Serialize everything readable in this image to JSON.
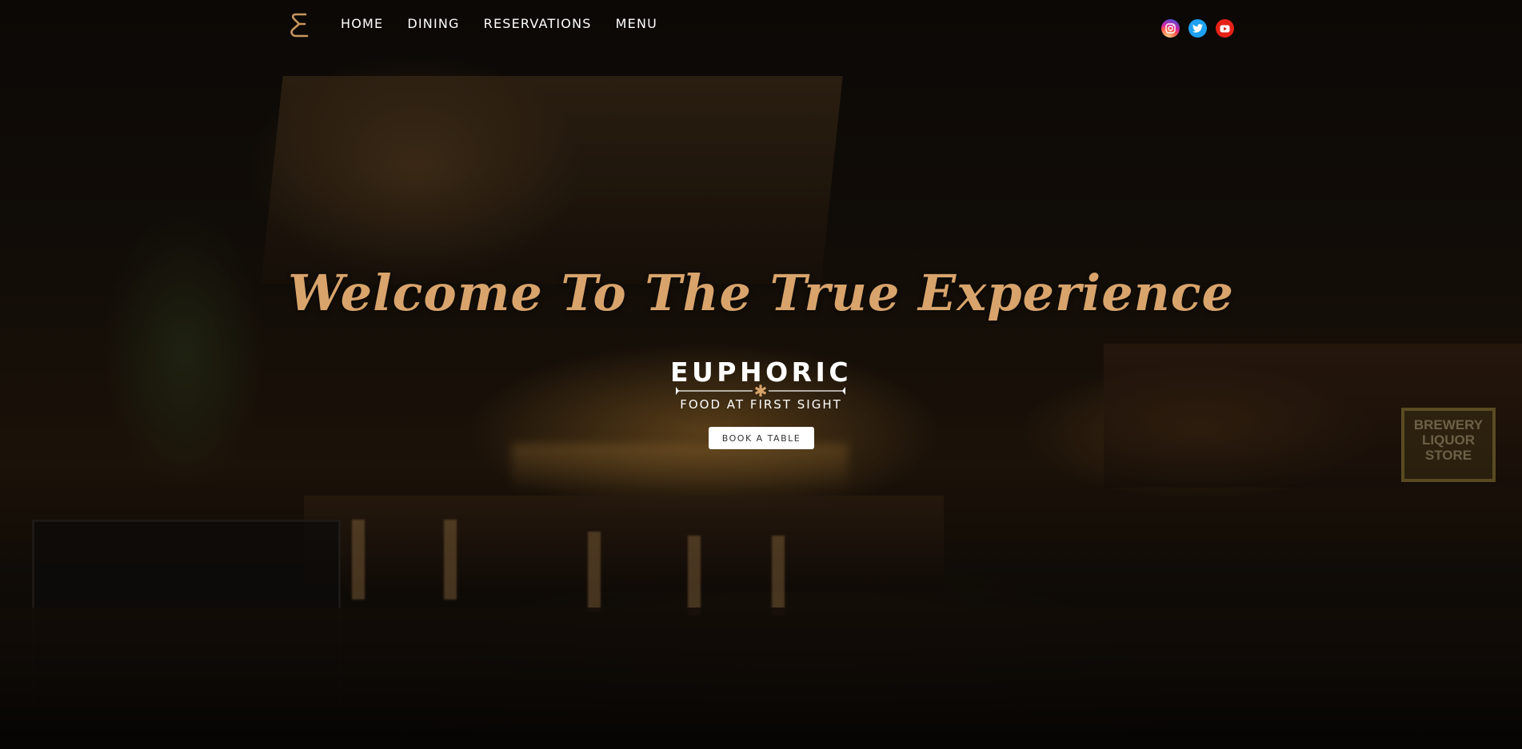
{
  "brand": {
    "logo_icon": "euphoric-e-logo-icon",
    "name": "EUPHORIC",
    "tagline": "FOOD AT FIRST SIGHT",
    "divider_icon": "asterisk-icon"
  },
  "nav": {
    "items": [
      {
        "label": "HOME"
      },
      {
        "label": "DINING"
      },
      {
        "label": "RESERVATIONS"
      },
      {
        "label": "MENU"
      }
    ]
  },
  "social": {
    "items": [
      {
        "icon": "instagram-icon",
        "color": "#c13584"
      },
      {
        "icon": "twitter-icon",
        "color": "#1da1f2"
      },
      {
        "icon": "youtube-icon",
        "color": "#e62117"
      }
    ]
  },
  "hero": {
    "title": "Welcome To The True Experience",
    "cta_label": "BOOK A TABLE"
  },
  "background": {
    "sign_text": "BREWERY LIQUOR STORE"
  },
  "colors": {
    "accent": "#d8a46c",
    "text": "#ffffff",
    "button_bg": "#ffffff",
    "button_text": "#333333"
  }
}
